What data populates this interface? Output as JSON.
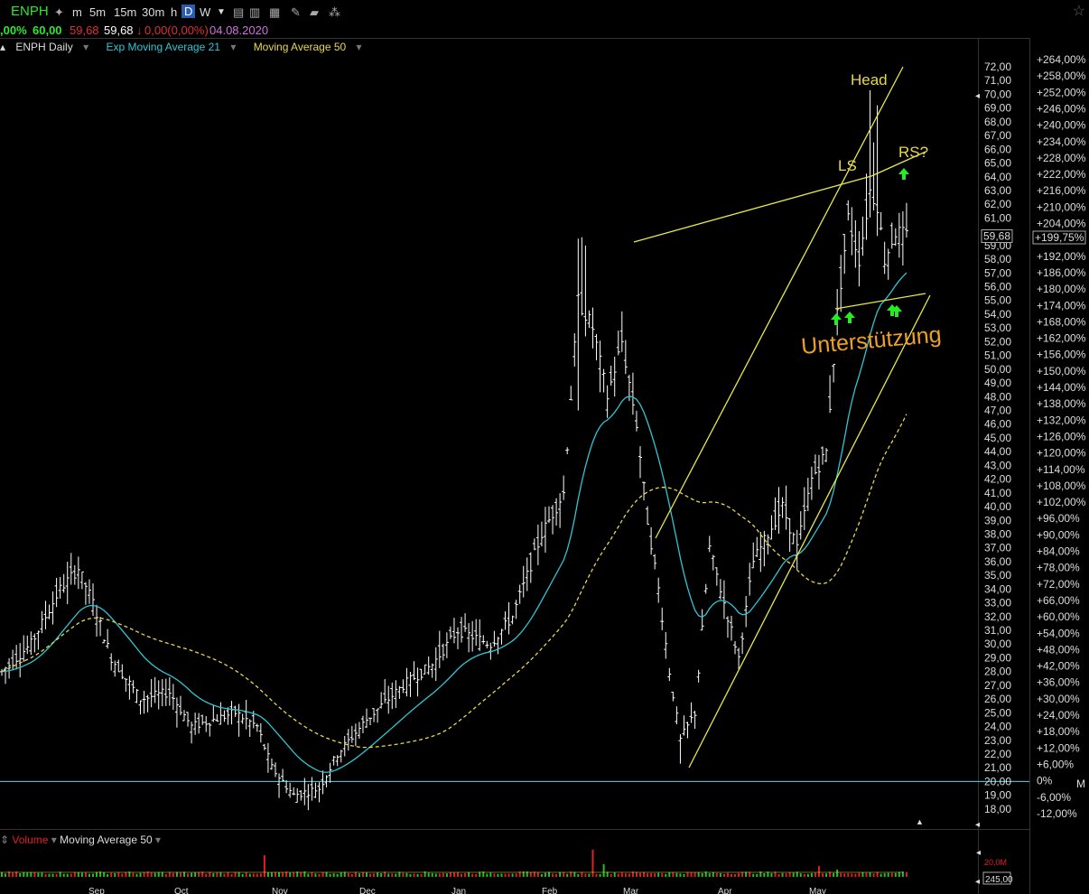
{
  "toolbar": {
    "symbol": "ENPH",
    "intervals": [
      "m",
      "5m",
      "15m",
      "30m",
      "h",
      "D",
      "W"
    ],
    "active_interval": "D"
  },
  "quote": {
    "change_pct": ",00%",
    "high": "60,00",
    "low": "59,68",
    "close": "59,68",
    "change": "0,00(0,00%)",
    "date": "04.08.2020"
  },
  "legend": {
    "main": "ENPH Daily",
    "ema": "Exp Moving Average 21",
    "sma": "Moving Average 50"
  },
  "volume_legend": {
    "label": "Volume",
    "ma": "Moving Average 50",
    "scale_top": "20,0M",
    "scale_last": "245,00"
  },
  "colors": {
    "background": "#000000",
    "bar": "#ffffff",
    "ema": "#2fc6d4",
    "sma": "#e8d84a",
    "trendline": "#e8e84a",
    "annotation": "#e8d84a",
    "support_text": "#f0a020",
    "arrow": "#22ee22",
    "baseline": "#2fc6d4",
    "vol_up": "#22c022",
    "vol_down": "#e02020"
  },
  "chart_data": {
    "type": "bar",
    "title": "ENPH Daily",
    "ylim": [
      17,
      73
    ],
    "last_price": "59,68",
    "last_pct": "+199,75%",
    "price_ticks": [
      "72,00",
      "71,00",
      "70,00",
      "69,00",
      "68,00",
      "67,00",
      "66,00",
      "65,00",
      "64,00",
      "63,00",
      "62,00",
      "61,00",
      "59,00",
      "58,00",
      "57,00",
      "56,00",
      "55,00",
      "54,00",
      "53,00",
      "52,00",
      "51,00",
      "50,00",
      "49,00",
      "48,00",
      "47,00",
      "46,00",
      "45,00",
      "44,00",
      "43,00",
      "42,00",
      "41,00",
      "40,00",
      "39,00",
      "38,00",
      "37,00",
      "36,00",
      "35,00",
      "34,00",
      "33,00",
      "32,00",
      "31,00",
      "30,00",
      "29,00",
      "28,00",
      "27,00",
      "26,00",
      "25,00",
      "24,00",
      "23,00",
      "22,00",
      "21,00",
      "20,00",
      "19,00",
      "18,00"
    ],
    "pct_ticks": [
      "+264,00%",
      "+258,00%",
      "+252,00%",
      "+246,00%",
      "+240,00%",
      "+234,00%",
      "+228,00%",
      "+222,00%",
      "+216,00%",
      "+210,00%",
      "+204,00%",
      "+192,00%",
      "+186,00%",
      "+180,00%",
      "+174,00%",
      "+168,00%",
      "+162,00%",
      "+156,00%",
      "+150,00%",
      "+144,00%",
      "+138,00%",
      "+132,00%",
      "+126,00%",
      "+120,00%",
      "+114,00%",
      "+108,00%",
      "+102,00%",
      "+96,00%",
      "+90,00%",
      "+84,00%",
      "+78,00%",
      "+72,00%",
      "+66,00%",
      "+60,00%",
      "+54,00%",
      "+48,00%",
      "+42,00%",
      "+36,00%",
      "+30,00%",
      "+24,00%",
      "+18,00%",
      "+12,00%",
      "+6,00%",
      "0%",
      "-6,00%",
      "-12,00%"
    ],
    "months": [
      "Sep",
      "Oct",
      "Nov",
      "Dec",
      "Jan",
      "Feb",
      "Mar",
      "Apr",
      "May"
    ],
    "baseline": 20,
    "annotations": {
      "head": "Head",
      "ls": "LS",
      "rs": "RS?",
      "support": "Unterstützung"
    },
    "anchors": [
      {
        "i": 0,
        "p": 28
      },
      {
        "i": 8,
        "p": 30
      },
      {
        "i": 16,
        "p": 34
      },
      {
        "i": 21,
        "p": 35.5
      },
      {
        "i": 25,
        "p": 33
      },
      {
        "i": 30,
        "p": 29
      },
      {
        "i": 38,
        "p": 26
      },
      {
        "i": 46,
        "p": 26.5
      },
      {
        "i": 52,
        "p": 24
      },
      {
        "i": 58,
        "p": 24.5
      },
      {
        "i": 64,
        "p": 25
      },
      {
        "i": 70,
        "p": 24
      },
      {
        "i": 74,
        "p": 21
      },
      {
        "i": 80,
        "p": 19
      },
      {
        "i": 87,
        "p": 19.5
      },
      {
        "i": 92,
        "p": 22
      },
      {
        "i": 100,
        "p": 24.5
      },
      {
        "i": 110,
        "p": 27
      },
      {
        "i": 118,
        "p": 28.5
      },
      {
        "i": 125,
        "p": 31
      },
      {
        "i": 134,
        "p": 30
      },
      {
        "i": 140,
        "p": 32
      },
      {
        "i": 148,
        "p": 38
      },
      {
        "i": 154,
        "p": 41
      },
      {
        "i": 158,
        "p": 55
      },
      {
        "i": 162,
        "p": 53
      },
      {
        "i": 166,
        "p": 48
      },
      {
        "i": 170,
        "p": 52
      },
      {
        "i": 174,
        "p": 46
      },
      {
        "i": 177,
        "p": 39
      },
      {
        "i": 180,
        "p": 34
      },
      {
        "i": 183,
        "p": 28
      },
      {
        "i": 186,
        "p": 23
      },
      {
        "i": 190,
        "p": 25
      },
      {
        "i": 194,
        "p": 37
      },
      {
        "i": 198,
        "p": 33
      },
      {
        "i": 202,
        "p": 29
      },
      {
        "i": 206,
        "p": 36
      },
      {
        "i": 210,
        "p": 38
      },
      {
        "i": 214,
        "p": 40
      },
      {
        "i": 218,
        "p": 37
      },
      {
        "i": 222,
        "p": 42
      },
      {
        "i": 226,
        "p": 44
      },
      {
        "i": 229,
        "p": 54
      },
      {
        "i": 232,
        "p": 61
      },
      {
        "i": 235,
        "p": 58
      },
      {
        "i": 238,
        "p": 63
      },
      {
        "i": 240,
        "p": 62
      },
      {
        "i": 242,
        "p": 58
      },
      {
        "i": 245,
        "p": 60
      },
      {
        "i": 248,
        "p": 59.68
      }
    ],
    "volume_spikes": [
      {
        "i": 72,
        "v": 24
      },
      {
        "i": 162,
        "v": 30
      },
      {
        "i": 165,
        "v": 14
      },
      {
        "i": 224,
        "v": 12
      },
      {
        "i": 229,
        "v": 8
      }
    ]
  }
}
